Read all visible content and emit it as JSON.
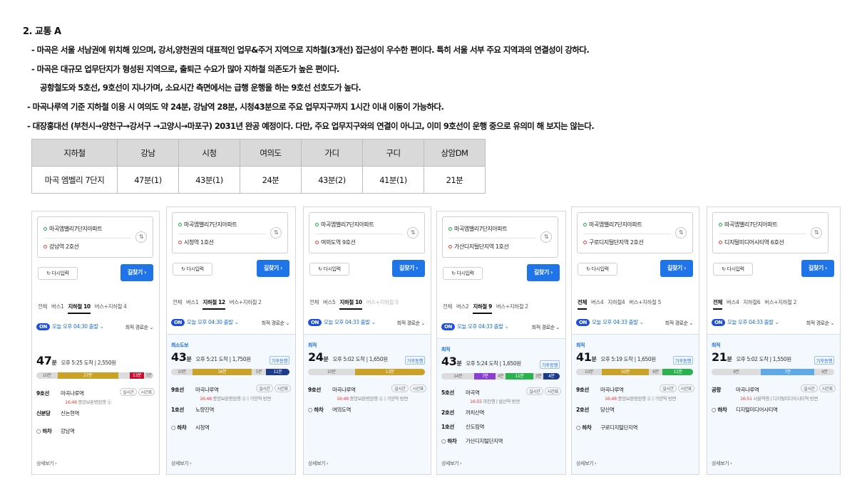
{
  "doc": {
    "title": "2. 교통 A",
    "bullets": [
      "- 마곡은 서울 서남권에 위치해 있으며, 강서,양천권의 대표적인 업무&주거 지역으로 지하철(3개선) 접근성이 우수한 편이다. 특히 서울 서부 주요 지역과의 연결성이 강하다.",
      "- 마곡은 대규모 업무단지가 형성된 지역으로, 출퇴근 수요가 많아 지하철 의존도가 높은 편이다.",
      "공항철도와 5호선, 9호선이 지나가며, 소요시간 측면에서는 급행 운행을 하는 9호선 선호도가 높다.",
      "- 마곡나루역 기준 지하철 이용 시 여의도 약 24분, 강남역 28분, 시청43분으로 주요 업무지구까지 1시간 이내 이동이 가능하다.",
      "- 대장홍대선 (부천시→양천구→강서구 →고양시→마포구) 2031년 완공 예정이다. 다만, 주요 업무지구와의 연결이 아니고, 이미 9호선이 운행 중으로 유의미 해 보지는 않는다."
    ]
  },
  "table": {
    "headers": [
      "지하철",
      "강남",
      "시청",
      "여의도",
      "가디",
      "구디",
      "상암DM"
    ],
    "row": [
      "마곡 엠벨리 7단지",
      "47분(1)",
      "43분(1)",
      "24분",
      "43분(2)",
      "41분(1)",
      "21분"
    ]
  },
  "colors": {
    "line9": "#c9a227",
    "line1": "#1e3a8a",
    "line2": "#2bb24c",
    "line5": "#8a3fd1",
    "line6": "#b5651d",
    "sinbundang": "#c8102e",
    "airport": "#5ea9e6",
    "blue": "#1f75e8"
  },
  "cards": [
    {
      "start": "마곡엠밸리7단지아파트",
      "end": "강남역 2호선",
      "reset": "다시입력",
      "route": "길찾기 ›",
      "tabs": [
        {
          "t": "전체"
        },
        {
          "t": "버스1"
        },
        {
          "t": "지하철 10",
          "a": true
        },
        {
          "t": "버스+지하철 4"
        }
      ],
      "on": "ON",
      "depart": "오늘 오후 04:30 출발 ⌄",
      "sort": "최적 경로순 ⌄",
      "tag": "",
      "minutes": "47",
      "unit": "분",
      "arrive": "오후 5:25 도착 | 2,550원",
      "badge": "",
      "segs": [
        {
          "w": 18,
          "c": "walk",
          "l": "10분"
        },
        {
          "w": 52,
          "c": "line9",
          "l": "27분"
        },
        {
          "w": 10,
          "c": "walk",
          "l": ""
        },
        {
          "w": 12,
          "c": "sinbundang",
          "l": "13분"
        },
        {
          "w": 8,
          "c": "walk",
          "l": "3분"
        }
      ],
      "stops": [
        {
          "line": "9호선",
          "st": "마곡나루역",
          "sub1": "16:48",
          "sub2": "중앙보훈병원행 ⓖ",
          "chip1": "실시간",
          "chip2": "시간표"
        },
        {
          "line": "신분당",
          "st": "신논현역",
          "sub1": "",
          "sub2": "",
          "chip1": "",
          "chip2": ""
        },
        {
          "line": "○ 하차",
          "st": "강남역",
          "sub1": "",
          "sub2": "",
          "chip1": "",
          "chip2": ""
        }
      ],
      "more": "상세보기 ›"
    },
    {
      "start": "마곡엠밸리7단지아파트",
      "end": "시청역 1호선",
      "reset": "다시입력",
      "route": "길찾기 ›",
      "tabs": [
        {
          "t": "전체"
        },
        {
          "t": "버스1"
        },
        {
          "t": "지하철 12",
          "a": true
        },
        {
          "t": "버스+지하철 2"
        }
      ],
      "on": "ON",
      "depart": "오늘 오후 04:30 출발 ⌄",
      "sort": "최적 경로순 ⌄",
      "tag": "최소도보",
      "minutes": "43",
      "unit": "분",
      "arrive": "오후 5:21 도착 | 1,750원",
      "badge": "기후동행",
      "segs": [
        {
          "w": 18,
          "c": "walk",
          "l": "10분"
        },
        {
          "w": 50,
          "c": "line9",
          "l": "16분"
        },
        {
          "w": 12,
          "c": "walk",
          "l": "5분"
        },
        {
          "w": 20,
          "c": "line1",
          "l": "11분"
        }
      ],
      "stops": [
        {
          "line": "9호선",
          "st": "마곡나루역",
          "sub1": "16:48",
          "sub2": "중앙보훈병원행 ⓖ | 가양역 방면",
          "chip1": "실시간",
          "chip2": "시간표"
        },
        {
          "line": "1호선",
          "st": "노량진역",
          "sub1": "",
          "sub2": "",
          "chip1": "",
          "chip2": ""
        },
        {
          "line": "○ 하차",
          "st": "시청역",
          "sub1": "",
          "sub2": "",
          "chip1": "",
          "chip2": ""
        }
      ],
      "more": "상세보기 ›"
    },
    {
      "start": "마곡엠밸리7단지아파트",
      "end": "여의도역 9호선",
      "reset": "다시입력",
      "route": "길찾기 ›",
      "tabs": [
        {
          "t": "전체"
        },
        {
          "t": "버스5"
        },
        {
          "t": "지하철 10",
          "a": true
        },
        {
          "t": "버스+지하철 0",
          "d": true
        }
      ],
      "on": "ON",
      "depart": "오늘 오후 04:33 출발 ⌄",
      "sort": "최적 경로순 ⌄",
      "tag": "최적",
      "minutes": "24",
      "unit": "분",
      "arrive": "오후 5:02 도착 | 1,650원",
      "badge": "기후동행",
      "segs": [
        {
          "w": 40,
          "c": "walk",
          "l": "10분"
        },
        {
          "w": 60,
          "c": "line9",
          "l": "13분"
        }
      ],
      "stops": [
        {
          "line": "9호선",
          "st": "마곡나루역",
          "sub1": "16:48",
          "sub2": "중앙보훈병원행 ⓖ | 가양역 방면",
          "chip1": "실시간",
          "chip2": "시간표"
        },
        {
          "line": "○ 하차",
          "st": "여의도역",
          "sub1": "",
          "sub2": "",
          "chip1": "",
          "chip2": ""
        }
      ],
      "more": "상세보기 ›"
    },
    {
      "start": "마곡엠밸리7단지아파트",
      "end": "가산디지털단지역 1호선",
      "reset": "다시입력",
      "route": "길찾기 ›",
      "tabs": [
        {
          "t": "전체"
        },
        {
          "t": "버스2"
        },
        {
          "t": "지하철 9",
          "a": true
        },
        {
          "t": "버스+지하철 2"
        }
      ],
      "on": "ON",
      "depart": "오늘 오후 04:33 출발 ⌄",
      "sort": "최적 경로순 ⌄",
      "tag": "최적",
      "minutes": "43",
      "unit": "분",
      "arrive": "오후 5:24 도착 | 1,650원",
      "badge": "기후동행",
      "segs": [
        {
          "w": 28,
          "c": "walk",
          "l": "14분"
        },
        {
          "w": 18,
          "c": "line5",
          "l": "7분"
        },
        {
          "w": 8,
          "c": "walk",
          "l": "4분"
        },
        {
          "w": 24,
          "c": "line2",
          "l": "11분"
        },
        {
          "w": 8,
          "c": "walk",
          "l": "3분"
        },
        {
          "w": 14,
          "c": "line1",
          "l": "4분"
        }
      ],
      "stops": [
        {
          "line": "5호선",
          "st": "마곡역",
          "sub1": "16:55",
          "sub2": "마천행 | 발산역 방면",
          "chip1": "실시간",
          "chip2": "시간표"
        },
        {
          "line": "2호선",
          "st": "까치산역",
          "sub1": "",
          "sub2": "",
          "chip1": "",
          "chip2": ""
        },
        {
          "line": "1호선",
          "st": "신도림역",
          "sub1": "",
          "sub2": "",
          "chip1": "",
          "chip2": ""
        },
        {
          "line": "○ 하차",
          "st": "가산디지털단지역",
          "sub1": "",
          "sub2": "",
          "chip1": "",
          "chip2": ""
        }
      ],
      "more": "상세보기 ›"
    },
    {
      "start": "마곡엠밸리7단지아파트",
      "end": "구로디지털단지역 2호선",
      "reset": "다시입력",
      "route": "길찾기 ›",
      "tabs": [
        {
          "t": "전체",
          "a": true
        },
        {
          "t": "버스4"
        },
        {
          "t": "지하철4"
        },
        {
          "t": "버스+지하철 5"
        }
      ],
      "on": "ON",
      "depart": "오늘 오후 04:33 출발 ⌄",
      "sort": "최적 경로순 ⌄",
      "tag": "최적",
      "minutes": "41",
      "unit": "분",
      "arrive": "오후 5:19 도착 | 1,650원",
      "badge": "기후동행",
      "segs": [
        {
          "w": 22,
          "c": "walk",
          "l": "10분"
        },
        {
          "w": 40,
          "c": "line9",
          "l": "10분"
        },
        {
          "w": 12,
          "c": "walk",
          "l": "6분"
        },
        {
          "w": 26,
          "c": "line2",
          "l": "11분"
        }
      ],
      "stops": [
        {
          "line": "9호선",
          "st": "마곡나루역",
          "sub1": "16:48",
          "sub2": "중앙보훈병원행 ⓖ | 가양역 방면",
          "chip1": "실시간",
          "chip2": "시간표"
        },
        {
          "line": "2호선",
          "st": "당산역",
          "sub1": "",
          "sub2": "",
          "chip1": "",
          "chip2": ""
        },
        {
          "line": "○ 하차",
          "st": "구로디지털단지역",
          "sub1": "",
          "sub2": "",
          "chip1": "",
          "chip2": ""
        }
      ],
      "more": "상세보기 ›"
    },
    {
      "start": "마곡엠밸리7단지아파트",
      "end": "디지털미디어시티역 6호선",
      "reset": "다시입력",
      "route": "길찾기 ›",
      "tabs": [
        {
          "t": "전체",
          "a": true
        },
        {
          "t": "버스4"
        },
        {
          "t": "지하철6"
        },
        {
          "t": "버스+지하철 2"
        }
      ],
      "on": "ON",
      "depart": "오늘 오후 04:33 출발 ⌄",
      "sort": "최적 경로순 ⌄",
      "tag": "최적",
      "minutes": "21",
      "unit": "분",
      "arrive": "오후 5:02 도착 | 1,550원",
      "badge": "기후동행",
      "segs": [
        {
          "w": 40,
          "c": "walk",
          "l": "9분"
        },
        {
          "w": 44,
          "c": "airport",
          "l": "7분"
        },
        {
          "w": 16,
          "c": "walk",
          "l": "4분"
        }
      ],
      "stops": [
        {
          "line": "공항",
          "st": "마곡나루역",
          "sub1": "16:51",
          "sub2": "서울역행 | 디지털미디어시티역 방면",
          "chip1": "실시간",
          "chip2": "시간표"
        },
        {
          "line": "○ 하차",
          "st": "디지털미디어시티역",
          "sub1": "",
          "sub2": "",
          "chip1": "",
          "chip2": ""
        }
      ],
      "more": "상세보기 ›"
    }
  ]
}
